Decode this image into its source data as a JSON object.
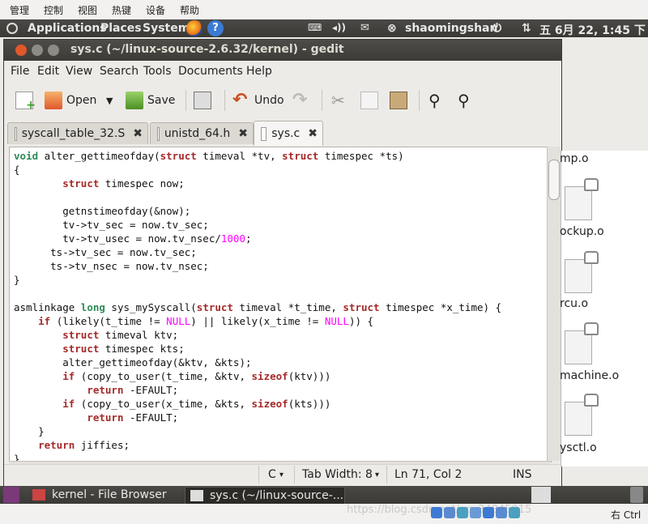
{
  "host_menu": [
    "管理",
    "控制",
    "视图",
    "热键",
    "设备",
    "帮助"
  ],
  "top_panel": {
    "applications": "Applications",
    "places": "Places",
    "system": "System",
    "user": "shaomingshan",
    "clock": "五 6月 22, 1:45 下"
  },
  "window": {
    "title": "sys.c (~/linux-source-2.6.32/kernel) - gedit"
  },
  "menubar": [
    "File",
    "Edit",
    "View",
    "Search",
    "Tools",
    "Documents",
    "Help"
  ],
  "toolbar": {
    "open_label": "Open",
    "save_label": "Save",
    "undo_label": "Undo"
  },
  "tabs": [
    {
      "label": "syscall_table_32.S",
      "active": false
    },
    {
      "label": "unistd_64.h",
      "active": false
    },
    {
      "label": "sys.c",
      "active": true
    }
  ],
  "editor": {
    "lines": [
      "void alter_gettimeofday(struct timeval *tv, struct timespec *ts)",
      "{",
      "        struct timespec now;",
      "",
      "        getnstimeofday(&now);",
      "        tv->tv_sec = now.tv_sec;",
      "        tv->tv_usec = now.tv_nsec/1000;",
      "      ts->tv_sec = now.tv_sec;",
      "      ts->tv_nsec = now.tv_nsec;",
      "}",
      "",
      "asmlinkage long sys_mySyscall(struct timeval *t_time, struct timespec *x_time) {",
      "    if (likely(t_time != NULL) || likely(x_time != NULL)) {",
      "        struct timeval ktv;",
      "        struct timespec kts;",
      "        alter_gettimeofday(&ktv, &kts);",
      "        if (copy_to_user(t_time, &ktv, sizeof(ktv)))",
      "            return -EFAULT;",
      "        if (copy_to_user(x_time, &kts, sizeof(kts)))",
      "            return -EFAULT;",
      "    }",
      "    return jiffies;",
      "}"
    ]
  },
  "statusbar": {
    "language": "C",
    "tab_width": "Tab Width:  8",
    "position": "Ln 71, Col 2",
    "mode": "INS"
  },
  "file_browser": {
    "files": [
      "mp.o",
      "ockup.o",
      "rcu.o",
      "machine.o",
      "ysctl.o"
    ]
  },
  "taskbar": {
    "items": [
      "kernel - File Browser",
      "sys.c (~/linux-source-..."
    ]
  },
  "tray": {
    "watermark": "https://blog.csdn.net/qq_34845015",
    "hotkey": "右 Ctrl"
  },
  "colors": {
    "keyword": "#a52a2a",
    "type": "#2e8b57",
    "number": "#ff00ff",
    "panel": "#3c3b37",
    "close_button": "#e0572b"
  }
}
